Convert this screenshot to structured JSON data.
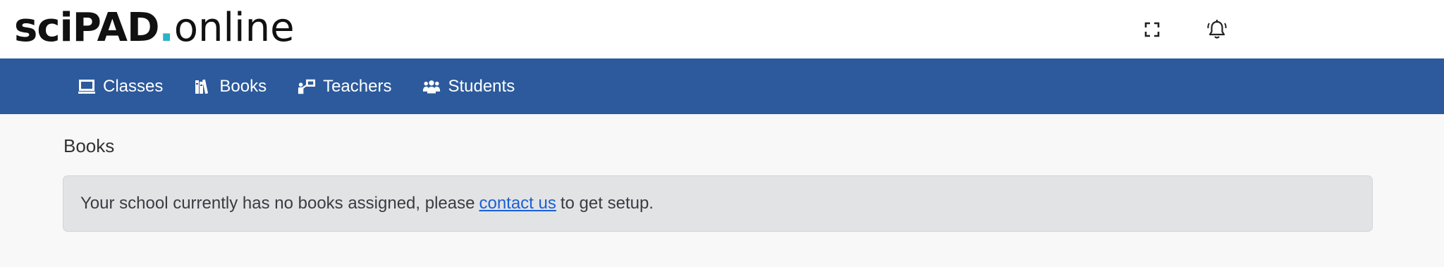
{
  "logo": {
    "part1": "sciPAD",
    "dot": ".",
    "part2": "online"
  },
  "topbar": {
    "icons": [
      "fullscreen-icon",
      "notification-bell-icon"
    ]
  },
  "nav": {
    "items": [
      {
        "label": "Classes",
        "icon": "classroom-icon"
      },
      {
        "label": "Books",
        "icon": "books-icon"
      },
      {
        "label": "Teachers",
        "icon": "teacher-icon"
      },
      {
        "label": "Students",
        "icon": "students-icon"
      }
    ]
  },
  "main": {
    "title": "Books",
    "alert": {
      "text_before": "Your school currently has no books assigned, please",
      "link_text": "contact us",
      "text_after": "to get setup."
    }
  },
  "colors": {
    "navbar": "#2c5a9c",
    "logo_dot": "#2bb3c8",
    "link": "#1a5fd6",
    "alert_bg": "#e2e3e5"
  }
}
